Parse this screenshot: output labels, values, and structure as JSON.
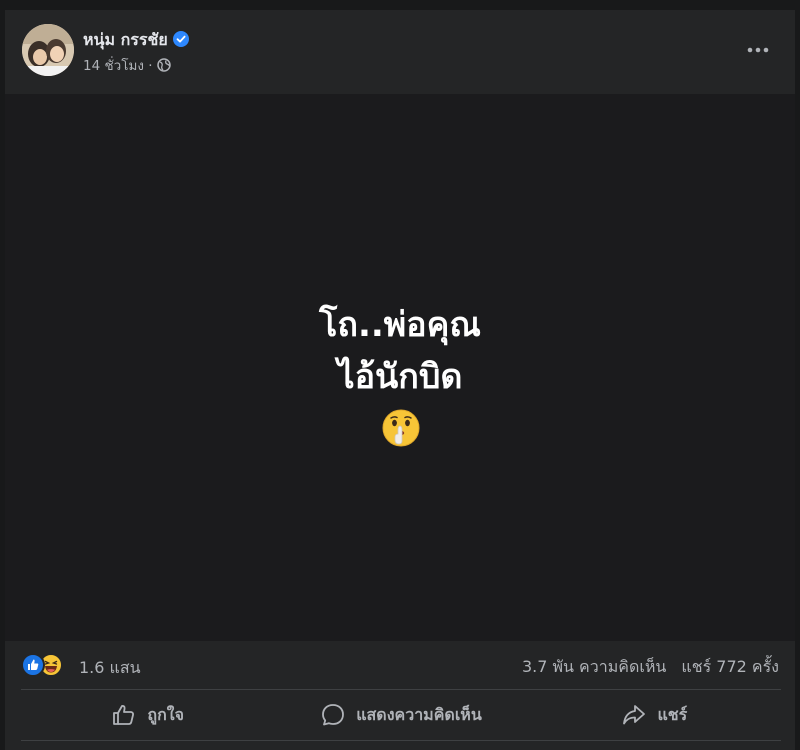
{
  "post": {
    "author": "หนุ่ม กรรชัย",
    "time": "14 ชั่วโมง",
    "separator": "·",
    "text_line1": "โถ..พ่อคุณ",
    "text_line2": "ไอ้นักบิด",
    "emoji": "shushing-face-icon"
  },
  "stats": {
    "reaction_count": "1.6 แสน",
    "comments": "3.7 พัน ความคิดเห็น",
    "shares": "แชร์ 772 ครั้ง"
  },
  "actions": {
    "like": "ถูกใจ",
    "comment": "แสดงความคิดเห็น",
    "share": "แชร์"
  },
  "colors": {
    "background": "#18191a",
    "card": "#242526",
    "media": "#1b1b1d",
    "text_primary": "#e4e6eb",
    "text_secondary": "#b0b3b8",
    "verified": "#2d88ff",
    "like_blue": "#1b74e4"
  }
}
